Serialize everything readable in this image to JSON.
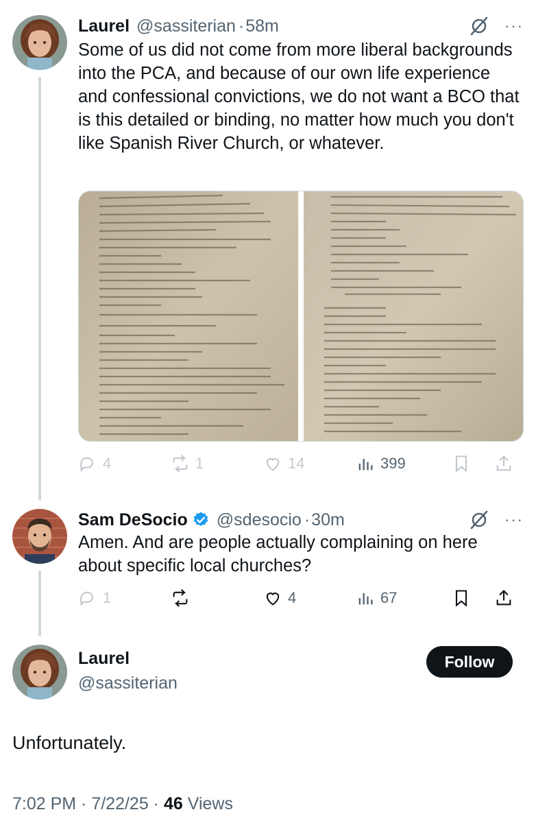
{
  "reply1": {
    "name": "Laurel",
    "handle": "@sassiterian",
    "time": "58m",
    "text": "Some of us did not come from more liberal backgrounds into the PCA, and because of our own life experience and confessional convictions, we do not want a BCO that is this detailed or binding, no matter how much you don't like Spanish River Church, or whatever.",
    "replies": "4",
    "reposts": "1",
    "likes": "14",
    "views": "399"
  },
  "reply2": {
    "name": "Sam DeSocio",
    "handle": "@sdesocio",
    "time": "30m",
    "text": "Amen. And are people actually complaining on here about specific local churches?",
    "replies": "1",
    "reposts": "",
    "likes": "4",
    "views": "67"
  },
  "main": {
    "name": "Laurel",
    "handle": "@sassiterian",
    "follow_label": "Follow",
    "text": "Unfortunately.",
    "timestamp": "7:02 PM · 7/22/25 ·",
    "views_count": "46",
    "views_label": "Views"
  },
  "separator": "·",
  "icons": {
    "grok": "grok-icon",
    "more": "more-icon",
    "reply": "reply-icon",
    "repost": "repost-icon",
    "like": "like-icon",
    "views": "views-icon",
    "bookmark": "bookmark-icon",
    "share": "share-icon",
    "verified": "verified-badge-icon"
  },
  "colors": {
    "text": "#0f1419",
    "secondary": "#536471",
    "thread_line": "#cfd9de",
    "verified": "#1d9bf0",
    "follow_bg": "#0f1419"
  }
}
